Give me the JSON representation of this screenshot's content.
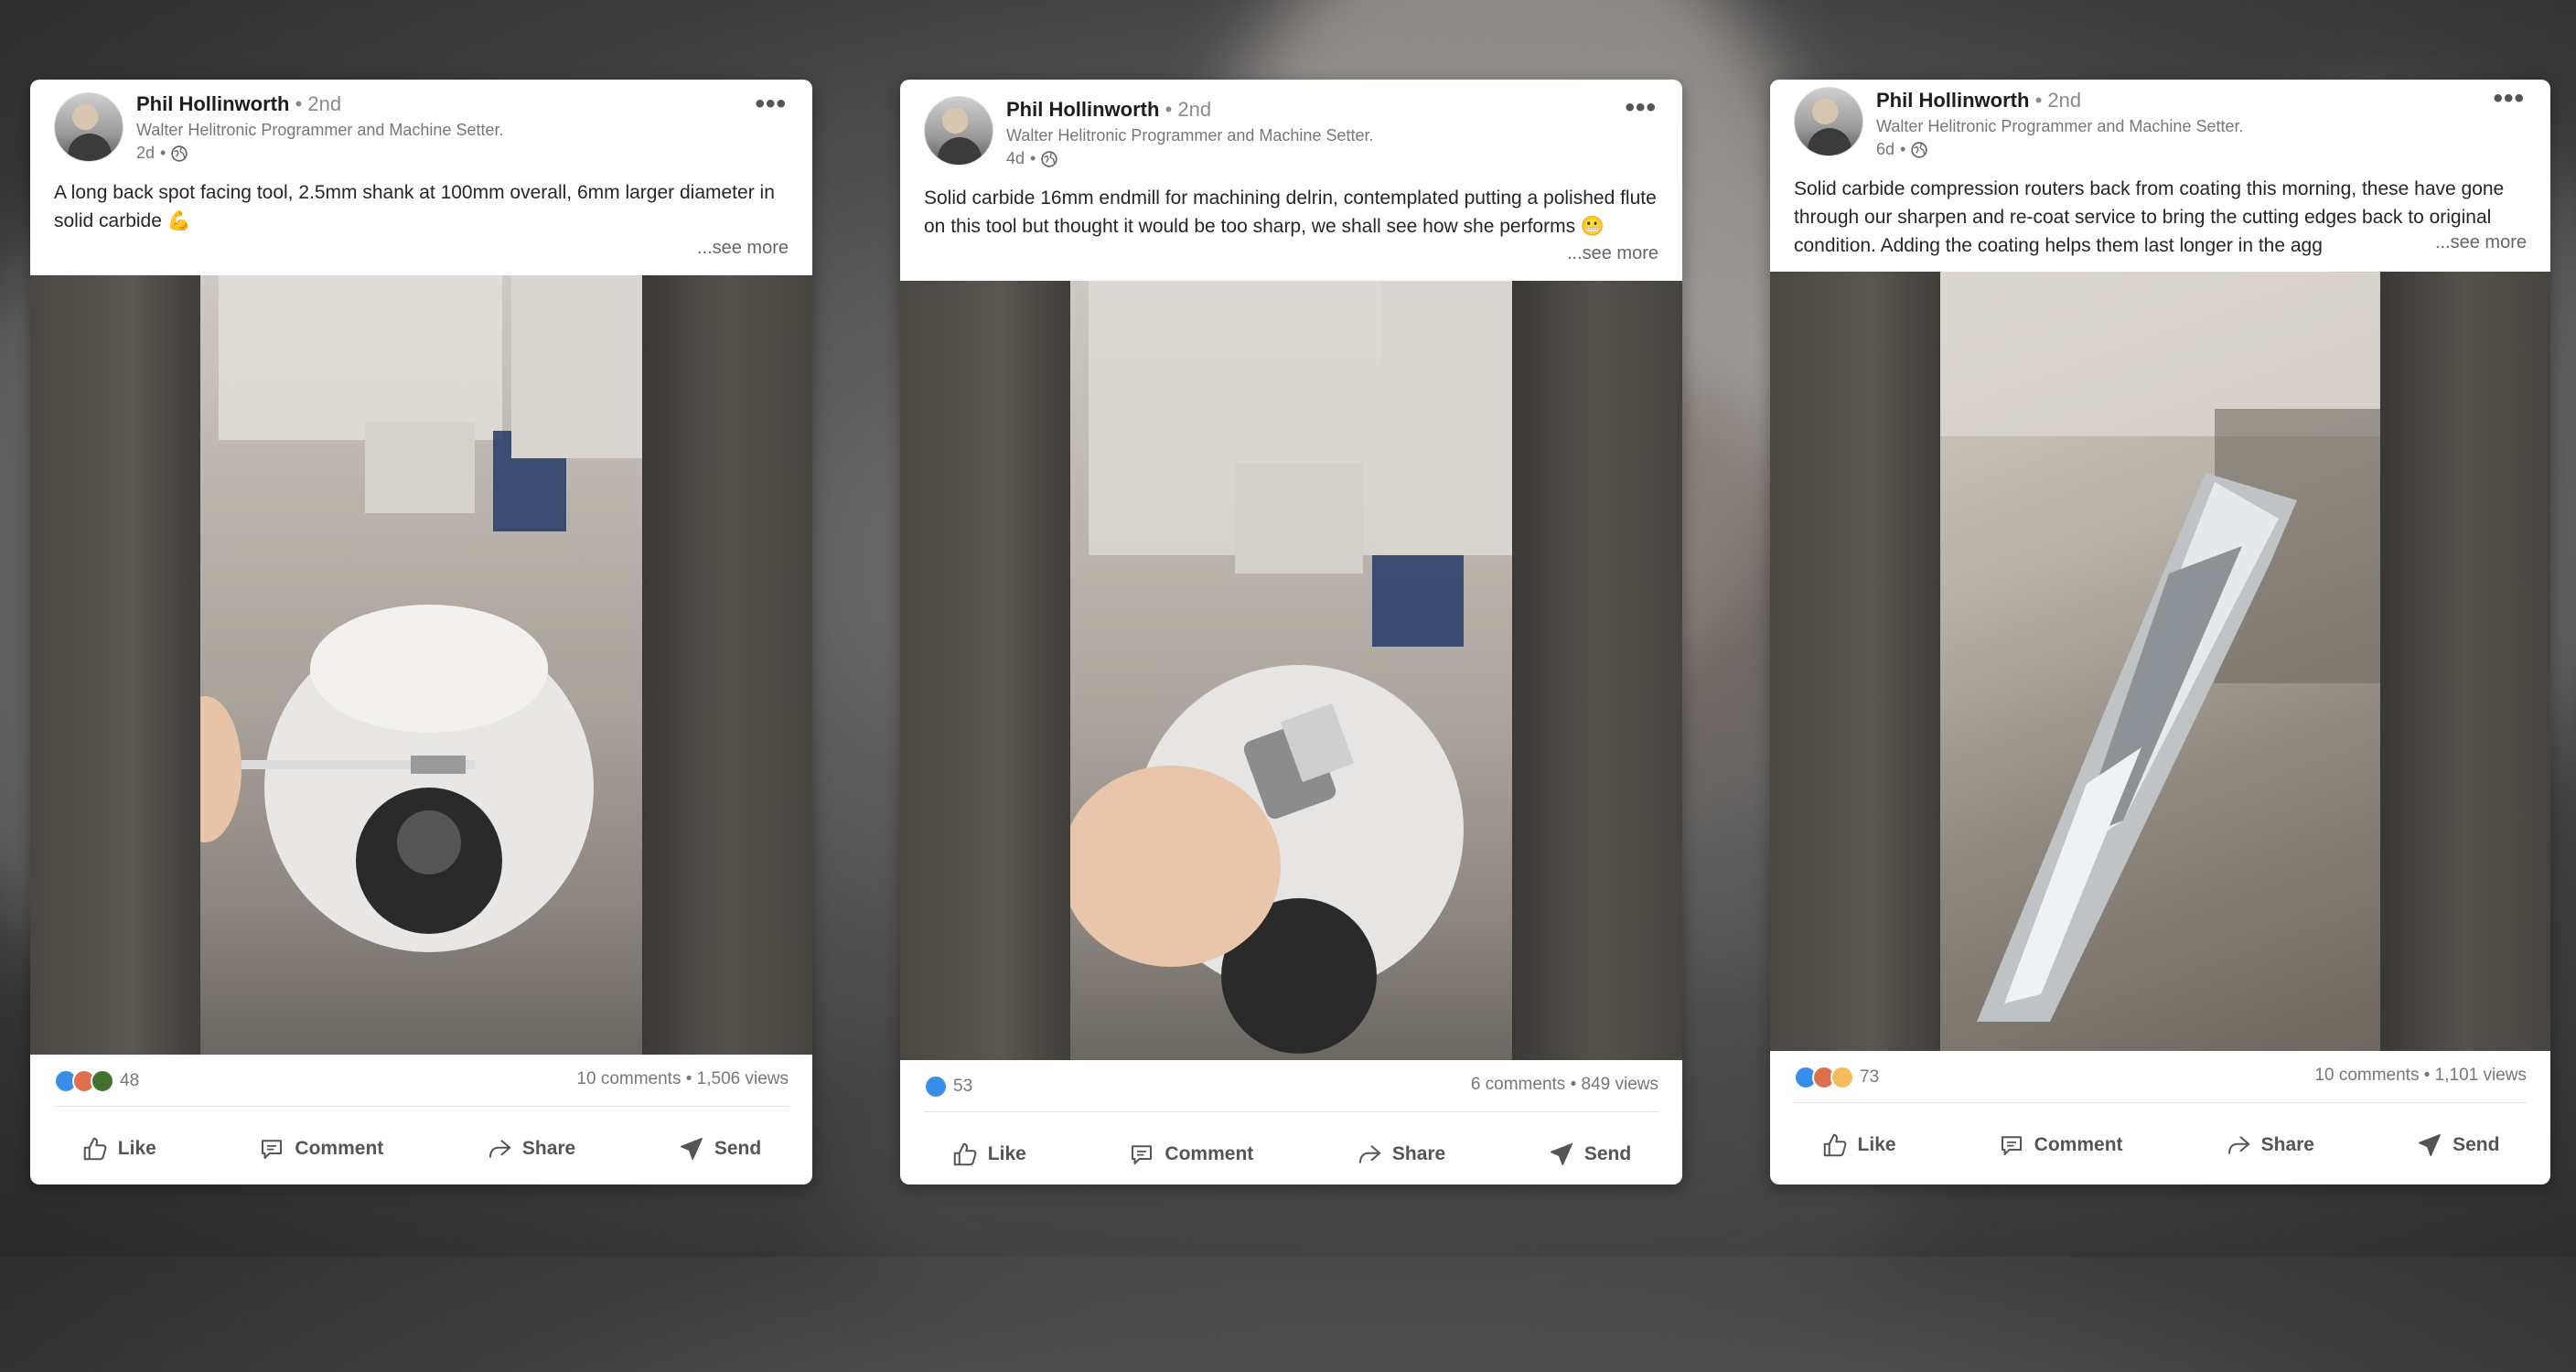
{
  "colors": {
    "card_bg": "#ffffff",
    "like_blue": "#378fe9",
    "love_red": "#df704d",
    "celebrate_green": "#44712e",
    "insightful_yellow": "#f5bb5c",
    "text_primary": "#262626",
    "text_secondary": "#777777"
  },
  "posts": [
    {
      "author_name": "Phil Hollinworth",
      "degree": "2nd",
      "author_title": "Walter Helitronic Programmer and Machine Setter.",
      "age": "2d",
      "text": "A long back spot facing tool, 2.5mm shank at 100mm overall, 6mm larger diameter in solid carbide 💪",
      "see_more": "...see more",
      "reactions": [
        "like",
        "love",
        "celebrate"
      ],
      "reaction_count": "48",
      "comments_views": "10 comments • 1,506 views",
      "media_subject": "spot-facing-tool-video"
    },
    {
      "author_name": "Phil Hollinworth",
      "degree": "2nd",
      "author_title": "Walter Helitronic Programmer and Machine Setter.",
      "age": "4d",
      "text": "Solid carbide 16mm endmill for machining delrin, contemplated putting a polished flute on this tool but thought it would be too sharp, we shall see how she performs 😬",
      "see_more": "...see more",
      "reactions": [
        "like"
      ],
      "reaction_count": "53",
      "comments_views": "6 comments • 849 views",
      "media_subject": "endmill-video"
    },
    {
      "author_name": "Phil Hollinworth",
      "degree": "2nd",
      "author_title": "Walter Helitronic Programmer and Machine Setter.",
      "age": "6d",
      "text": "Solid carbide compression routers back from coating this morning, these have gone through our sharpen and re-coat service to bring the cutting edges back to original condition. Adding the coating helps them last longer in the agg",
      "see_more": "...see more",
      "reactions": [
        "like",
        "love",
        "insightful"
      ],
      "reaction_count": "73",
      "comments_views": "10 comments • 1,101 views",
      "media_subject": "compression-router-video"
    }
  ],
  "actions": {
    "like": "Like",
    "comment": "Comment",
    "share": "Share",
    "send": "Send"
  }
}
